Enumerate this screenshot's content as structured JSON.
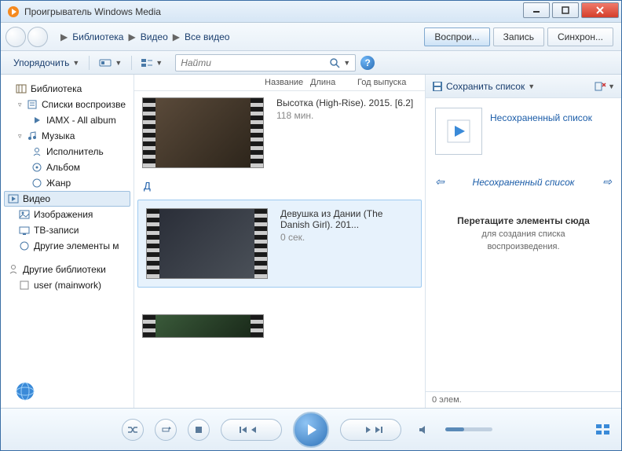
{
  "window": {
    "title": "Проигрыватель Windows Media"
  },
  "breadcrumb": {
    "a": "Библиотека",
    "b": "Видео",
    "c": "Все видео"
  },
  "tabs": {
    "play": "Воспрои...",
    "burn": "Запись",
    "sync": "Синхрон..."
  },
  "toolbar": {
    "organize": "Упорядочить",
    "search_placeholder": "Найти",
    "save_list": "Сохранить список"
  },
  "columns": {
    "name": "Название",
    "length": "Длина",
    "year": "Год выпуска"
  },
  "sidebar": {
    "library": "Библиотека",
    "playlists": "Списки воспроизве",
    "iamx": "IAMX - All album",
    "music": "Музыка",
    "artist": "Исполнитель",
    "album": "Альбом",
    "genre": "Жанр",
    "video": "Видео",
    "images": "Изображения",
    "tv": "ТВ-записи",
    "other": "Другие элементы м",
    "otherlib": "Другие библиотеки",
    "user": "user (mainwork)"
  },
  "items": {
    "v1_title": "Высотка (High-Rise). 2015. [6.2]",
    "v1_dur": "118 мин.",
    "letter_d": "Д",
    "v2_title": "Девушка из Дании (The Danish Girl). 201...",
    "v2_dur": "0 сек."
  },
  "playlist": {
    "unsaved_link": "Несохраненный список",
    "header": "Несохраненный список",
    "drop_title": "Перетащите элементы сюда",
    "drop_sub1": "для создания списка",
    "drop_sub2": "воспроизведения.",
    "count": "0 элем."
  }
}
